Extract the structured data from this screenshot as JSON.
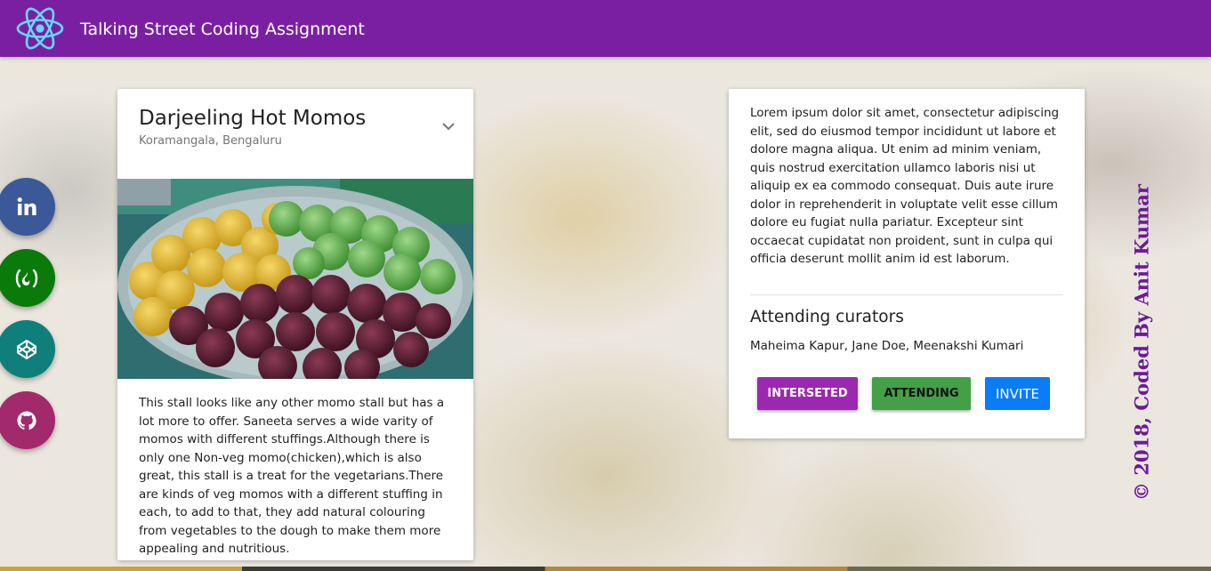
{
  "app": {
    "title": "Talking Street Coding Assignment",
    "logo_icon": "react-atom-icon",
    "header_color": "#7b1fa2"
  },
  "social": [
    {
      "name": "linkedin",
      "icon": "linkedin-icon",
      "color": "#3b5998"
    },
    {
      "name": "freecodecamp",
      "icon": "freecodecamp-icon",
      "color": "#0a7a0a"
    },
    {
      "name": "codepen",
      "icon": "codepen-icon",
      "color": "#0f7f7b"
    },
    {
      "name": "github",
      "icon": "github-icon",
      "color": "#a2296b"
    }
  ],
  "stall_card": {
    "title": "Darjeeling Hot Momos",
    "subtitle": "Koramangala, Bengaluru",
    "expand_icon": "chevron-down-icon",
    "description": "This stall looks like any other momo stall but has a lot more to offer. Saneeta serves a wide varity of momos with different stuffings.Although there is only one Non-veg momo(chicken),which is also great, this stall is a treat for the vegetarians.There are kinds of veg momos with a different stuffing in each, to add to that, they add natural colouring from vegetables to the dough to make them more appealing and nutritious."
  },
  "details_card": {
    "lorem": "Lorem ipsum dolor sit amet, consectetur adipiscing elit, sed do eiusmod tempor incididunt ut labore et dolore magna aliqua. Ut enim ad minim veniam, quis nostrud exercitation ullamco laboris nisi ut aliquip ex ea commodo consequat. Duis aute irure dolor in reprehenderit in voluptate velit esse cillum dolore eu fugiat nulla pariatur. Excepteur sint occaecat cupidatat non proident, sunt in culpa qui officia deserunt mollit anim id est laborum.",
    "curators_title": "Attending curators",
    "curators": "Maheima Kapur, Jane Doe, Meenakshi Kumari",
    "buttons": {
      "interested": "INTERSETED",
      "attending": "ATTENDING",
      "invite": "INVITE"
    },
    "button_colors": {
      "interested": "#9c27b0",
      "attending": "#43a047",
      "invite": "#0a7cf5"
    }
  },
  "credit": "© 2018, Coded By Anit Kumar"
}
